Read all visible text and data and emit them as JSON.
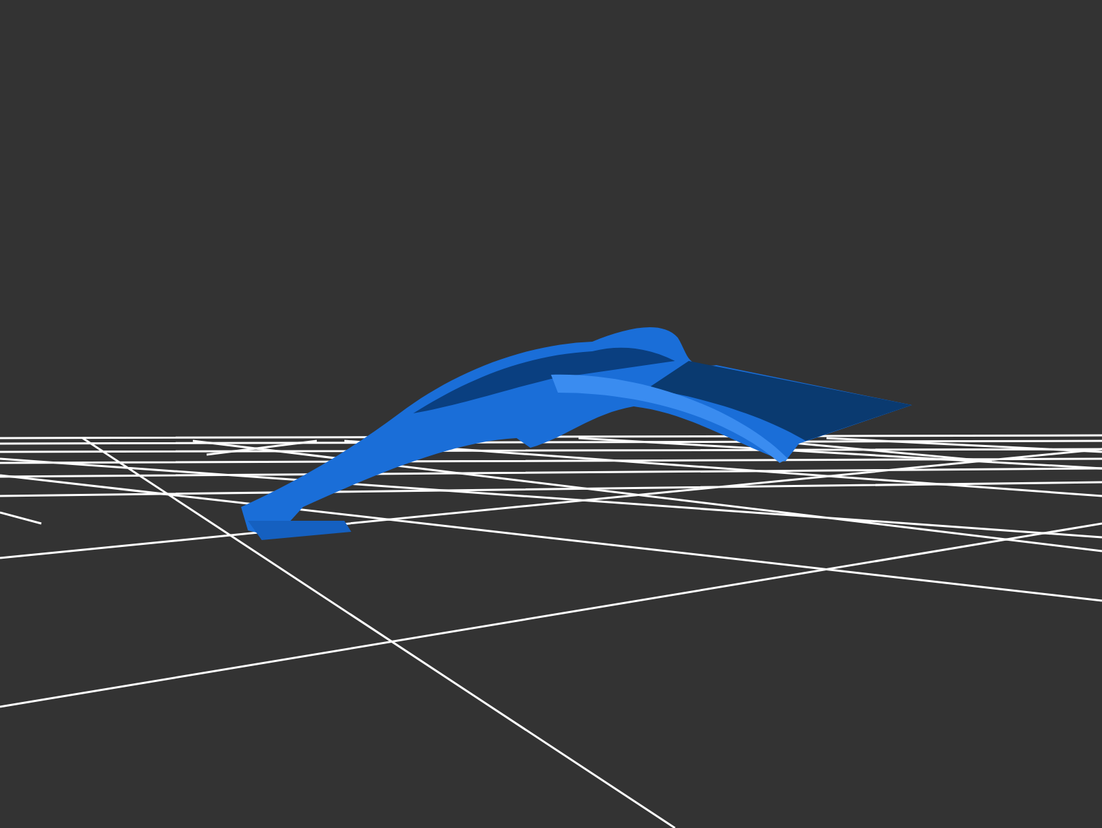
{
  "viewport": {
    "kind": "scene"
  }
}
